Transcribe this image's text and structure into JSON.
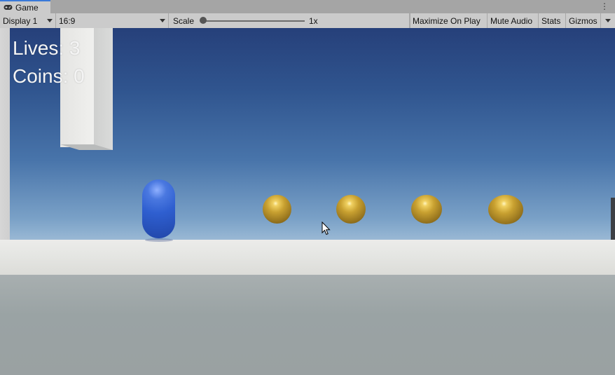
{
  "tab": {
    "label": "Game",
    "icon": "gamepad-icon"
  },
  "toolbar": {
    "display": "Display 1",
    "aspect": "16:9",
    "scale_label": "Scale",
    "scale_value": "1x",
    "maximize": "Maximize On Play",
    "mute": "Mute Audio",
    "stats": "Stats",
    "gizmos": "Gizmos"
  },
  "hud": {
    "lives": "Lives: 3",
    "coins": "Coins: 0"
  },
  "colors": {
    "tab_accent": "#3a79d8",
    "player": "#2f5fd0",
    "coin": "#c8a030"
  }
}
